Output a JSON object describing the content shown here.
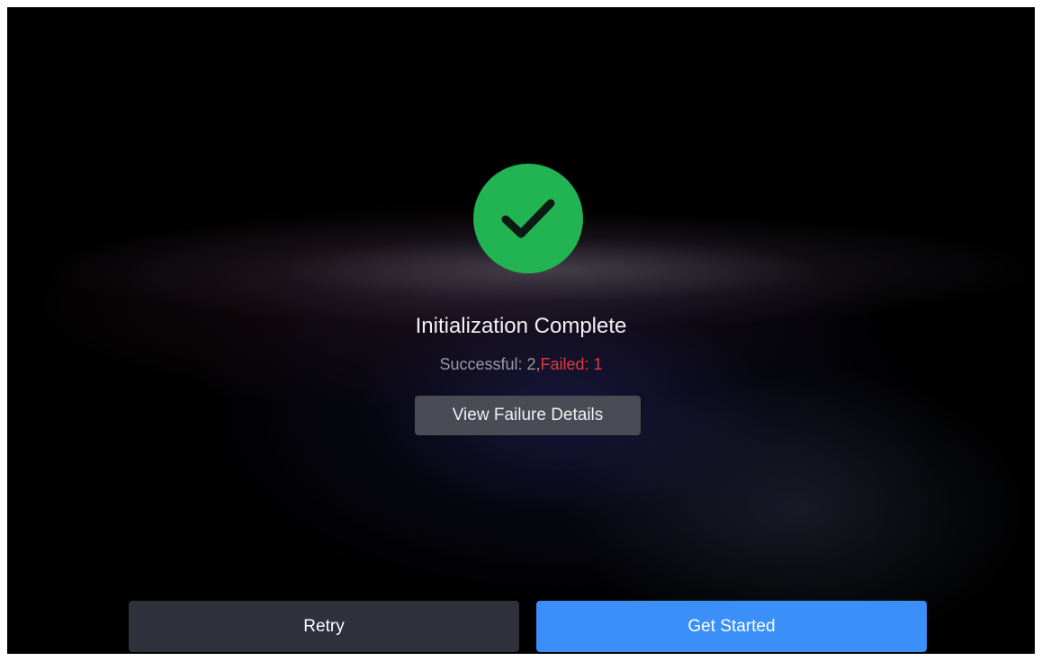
{
  "status": {
    "title": "Initialization Complete",
    "success_text": "Successful: 2,",
    "failed_text": "Failed: 1",
    "success_count": 2,
    "failed_count": 1,
    "icon": "check-circle-icon",
    "icon_color": "#22b452",
    "failed_color": "#e23b3b"
  },
  "actions": {
    "view_details_label": "View Failure Details",
    "retry_label": "Retry",
    "get_started_label": "Get Started",
    "primary_color": "#3a8ff8"
  }
}
